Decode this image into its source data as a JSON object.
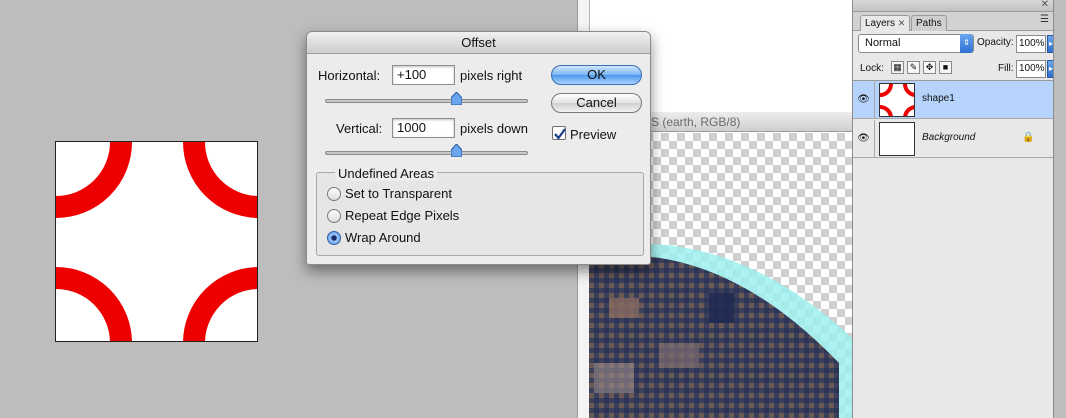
{
  "dialog": {
    "title": "Offset",
    "horizontal_label": "Horizontal:",
    "horizontal_value": "+100",
    "horizontal_unit": "pixels right",
    "vertical_label": "Vertical:",
    "vertical_value": "1000",
    "vertical_unit": "pixels down",
    "ok_label": "OK",
    "cancel_label": "Cancel",
    "preview_label": "Preview",
    "preview_checked": true,
    "undefined_areas": {
      "title": "Undefined Areas",
      "options": [
        {
          "label": "Set to Transparent",
          "selected": false
        },
        {
          "label": "Repeat Edge Pixels",
          "selected": false
        },
        {
          "label": "Wrap Around",
          "selected": true
        }
      ]
    }
  },
  "document": {
    "title_fragment": "S (earth, RGB/8)"
  },
  "layers_panel": {
    "tabs": [
      {
        "label": "Layers",
        "active": true
      },
      {
        "label": "Paths",
        "active": false
      }
    ],
    "blend_mode": "Normal",
    "opacity_label": "Opacity:",
    "opacity_value": "100%",
    "lock_label": "Lock:",
    "fill_label": "Fill:",
    "fill_value": "100%",
    "layers": [
      {
        "name": "shape1",
        "selected": true,
        "italic": false
      },
      {
        "name": "Background",
        "selected": false,
        "italic": true
      }
    ]
  },
  "colors": {
    "shape_red": "#ee0000",
    "selected_layer": "#b6d4fb",
    "earth_glow": "#9ef0ee"
  },
  "icons": {
    "visibility": "eye-icon",
    "lock": "lock-icon",
    "panel_menu": "panel-menu-icon",
    "close": "close-icon"
  }
}
